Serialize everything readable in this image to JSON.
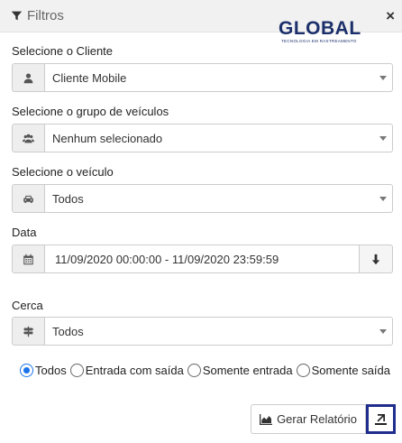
{
  "header": {
    "title": "Filtros",
    "filter_icon": "filter-icon",
    "close_label": "×"
  },
  "logo": {
    "name": "GLOBAL",
    "subtitle": "TECNOLOGIA EM RASTREAMENTO"
  },
  "fields": {
    "cliente": {
      "label": "Selecione o Cliente",
      "value": "Cliente Mobile",
      "icon": "user-icon"
    },
    "grupo": {
      "label": "Selecione o grupo de veículos",
      "value": "Nenhum selecionado",
      "icon": "users-icon"
    },
    "veiculo": {
      "label": "Selecione o veículo",
      "value": "Todos",
      "icon": "car-icon"
    },
    "data": {
      "label": "Data",
      "value": "11/09/2020 00:00:00 - 11/09/2020 23:59:59",
      "icon": "calendar-icon",
      "button_icon": "arrow-down-icon"
    },
    "cerca": {
      "label": "Cerca",
      "value": "Todos",
      "icon": "signpost-icon"
    }
  },
  "radios": {
    "options": [
      "Todos",
      "Entrada com saída",
      "Somente entrada",
      "Somente saída"
    ],
    "selected": "Todos"
  },
  "actions": {
    "report_label": "Gerar Relatório",
    "report_icon": "area-chart-icon",
    "export_icon": "export-icon"
  },
  "colors": {
    "header_bg": "#f1f1f1",
    "radio_accent": "#1a73e8",
    "export_border": "#1f2d8c",
    "logo_color": "#1b2f6b"
  }
}
